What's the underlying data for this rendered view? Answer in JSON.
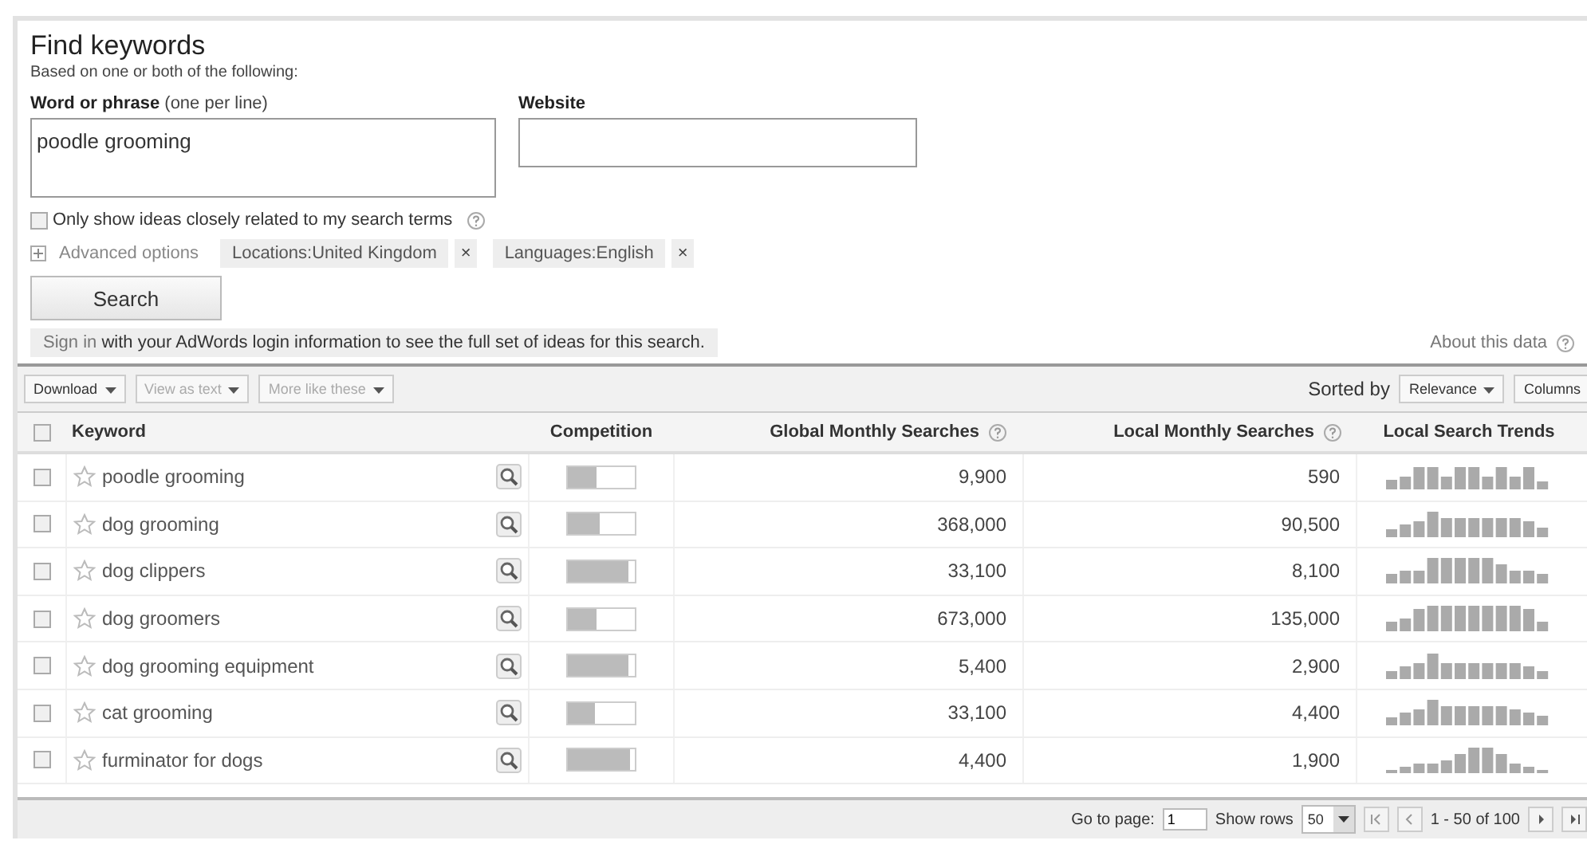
{
  "title": "Find keywords",
  "subtitle": "Based on one or both of the following:",
  "phrase_field": {
    "label": "Word or phrase",
    "hint": "(one per line)",
    "value": "poodle grooming"
  },
  "website_field": {
    "label": "Website"
  },
  "close_match": {
    "label": "Only show ideas closely related to my search terms",
    "checked": false
  },
  "advanced": {
    "label": "Advanced options",
    "expanded": false,
    "filters": [
      {
        "label": "Locations:United Kingdom",
        "remove": "×"
      },
      {
        "label": "Languages:English",
        "remove": "×"
      }
    ]
  },
  "search_button": "Search",
  "sign_in": {
    "link": "Sign in",
    "text": "with your AdWords login information to see the full set of ideas for this search."
  },
  "about": "About this data",
  "toolbar": {
    "buttons": [
      {
        "label": "Download",
        "disabled": false
      },
      {
        "label": "View as text",
        "disabled": true
      },
      {
        "label": "More like these",
        "disabled": true
      }
    ],
    "sorted_by": "Sorted by",
    "sort": "Relevance",
    "columns": "Columns"
  },
  "table": {
    "select_all": {
      "checked": false
    },
    "columns": [
      {
        "label": "Keyword",
        "help": false
      },
      {
        "label": "Competition",
        "help": false
      },
      {
        "label": "Global Monthly Searches",
        "help": true
      },
      {
        "label": "Local Monthly Searches",
        "help": true
      },
      {
        "label": "Local Search Trends",
        "help": false
      }
    ],
    "rows": [
      {
        "keyword": "poodle grooming",
        "checked": false,
        "level": 0.42,
        "global": "9,900",
        "local": "590"
      },
      {
        "keyword": "dog grooming",
        "checked": false,
        "level": 0.47,
        "global": "368,000",
        "local": "90,500"
      },
      {
        "keyword": "dog clippers",
        "checked": false,
        "level": 0.9,
        "global": "33,100",
        "local": "8,100"
      },
      {
        "keyword": "dog groomers",
        "checked": false,
        "level": 0.42,
        "global": "673,000",
        "local": "135,000"
      },
      {
        "keyword": "dog grooming equipment",
        "checked": false,
        "level": 0.9,
        "global": "5,400",
        "local": "2,900"
      },
      {
        "keyword": "cat grooming",
        "checked": false,
        "level": 0.4,
        "global": "33,100",
        "local": "4,400"
      },
      {
        "keyword": "furminator for dogs",
        "checked": false,
        "level": 0.93,
        "global": "4,400",
        "local": "1,900"
      }
    ]
  },
  "pager": {
    "goto_label": "Go to page:",
    "page": "1",
    "rows_label": "Show rows",
    "rows": "50",
    "range": "1 - 50 of 100"
  }
}
